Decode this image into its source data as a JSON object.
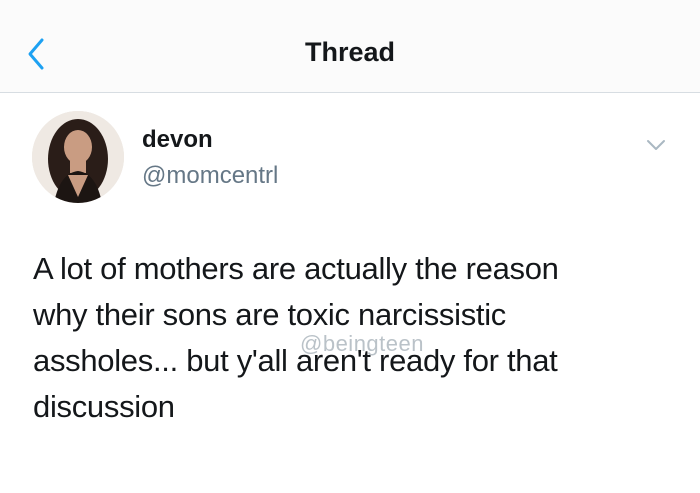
{
  "header": {
    "title": "Thread",
    "back_icon": "chevron-left-icon",
    "accent_color": "#1da1f2"
  },
  "tweet": {
    "display_name": "devon",
    "handle": "@momcentrl",
    "menu_icon": "chevron-down-icon",
    "lines": [
      "A lot of mothers are actually the reason",
      "why their sons are toxic narcissistic",
      "assholes... but y'all aren't ready for that",
      "discussion"
    ],
    "watermark": "@beingteen"
  }
}
